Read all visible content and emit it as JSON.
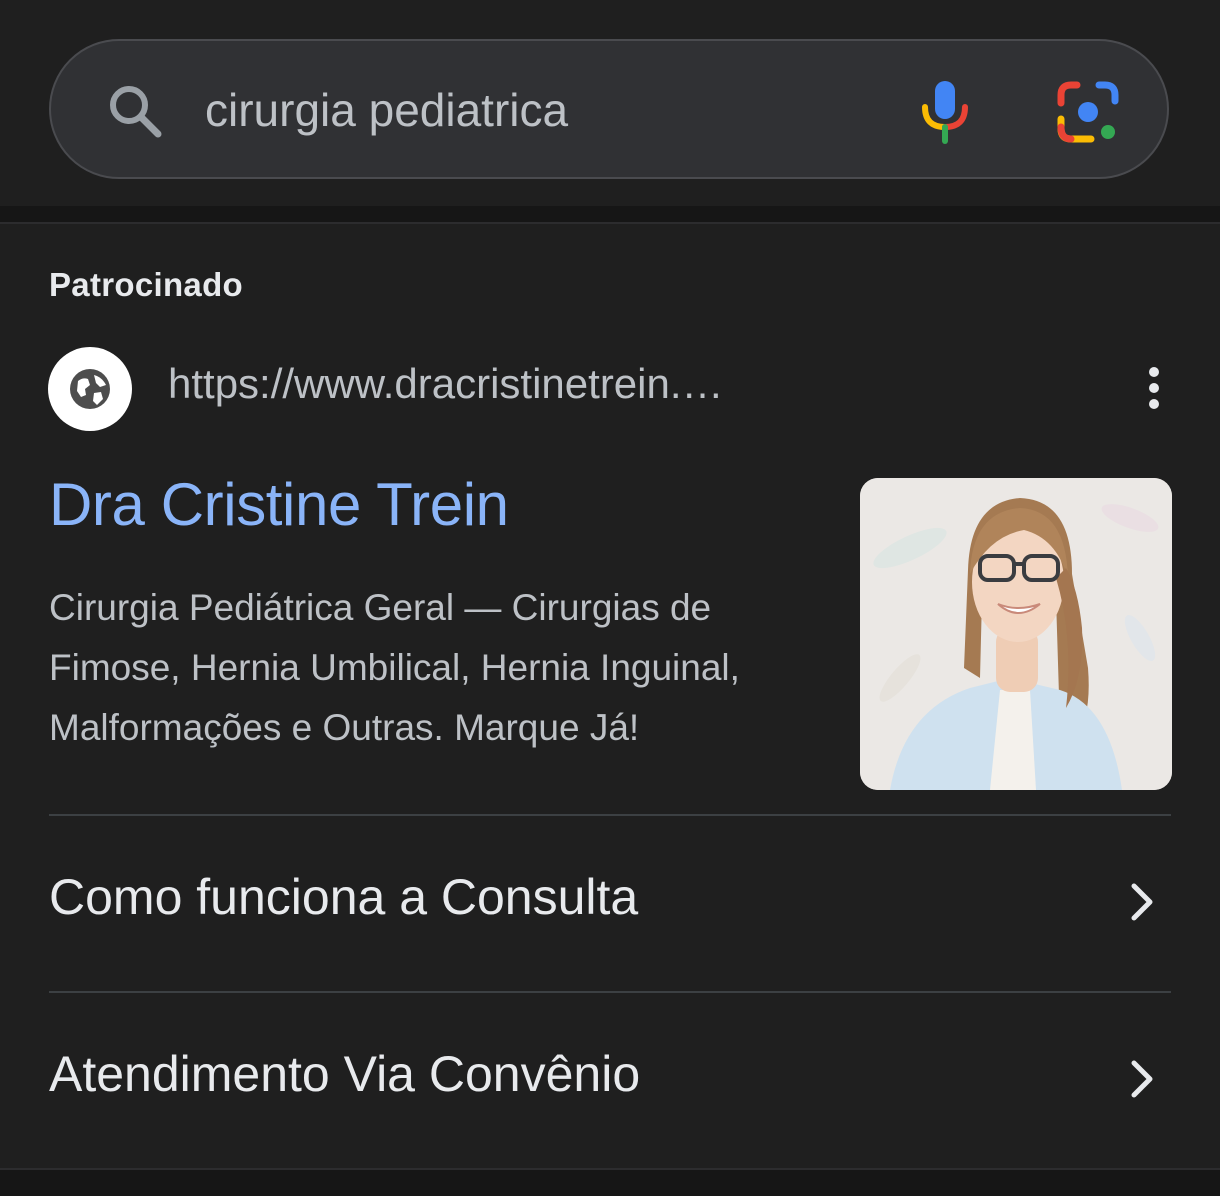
{
  "search": {
    "query": "cirurgia pediatrica",
    "search_icon": "search-icon",
    "voice_icon": "microphone-icon",
    "lens_icon": "google-lens-icon"
  },
  "ad": {
    "sponsored_label": "Patrocinado",
    "favicon_icon": "globe-icon",
    "url": "https://www.dracristinetrein.…",
    "more_icon": "more-vert-icon",
    "title": "Dra Cristine Trein",
    "description": "Cirurgia Pediátrica Geral — Cirurgias de Fimose, Hernia Umbilical, Hernia Inguinal, Malformações e Outras. Marque Já!",
    "image": "doctor-portrait-photo"
  },
  "sitelinks": [
    {
      "label": "Como funciona a Consulta",
      "icon": "chevron-right-icon"
    },
    {
      "label": "Atendimento Via Convênio",
      "icon": "chevron-right-icon"
    }
  ],
  "colors": {
    "background": "#1f1f1f",
    "search_bar": "#303134",
    "title_link": "#8ab4f8",
    "primary_text": "#e8eaed",
    "secondary_text": "#bdc1c6"
  }
}
